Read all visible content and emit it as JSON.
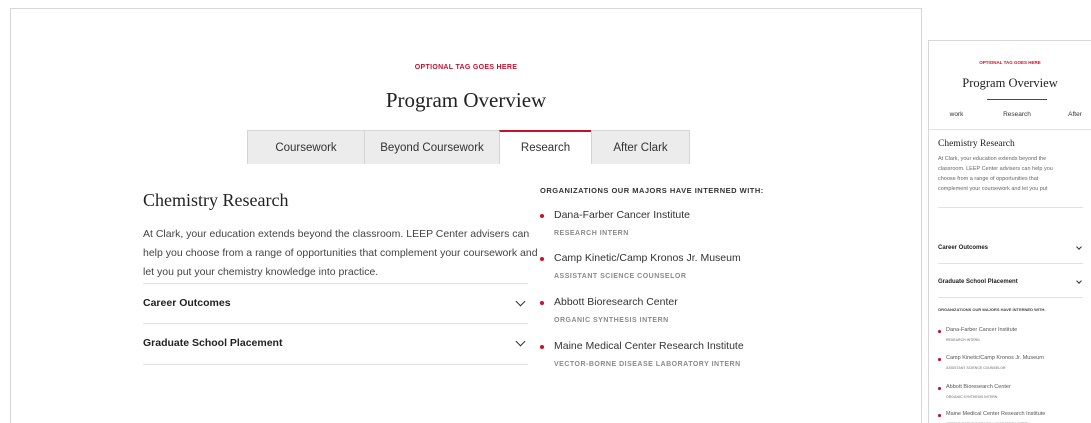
{
  "header": {
    "tag": "OPTIONAL TAG GOES HERE",
    "title": "Program Overview"
  },
  "tabs": [
    {
      "label": "Coursework",
      "active": false
    },
    {
      "label": "Beyond Coursework",
      "active": false
    },
    {
      "label": "Research",
      "active": true
    },
    {
      "label": "After Clark",
      "active": false
    }
  ],
  "content": {
    "heading": "Chemistry Research",
    "body": "At Clark, your education extends beyond the classroom. LEEP Center advisers can help you choose from a range of opportunities that complement your coursework and let you put your chemistry knowledge into practice."
  },
  "accordions": [
    {
      "label": "Career Outcomes",
      "icon": "chevron-down-icon"
    },
    {
      "label": "Graduate School Placement",
      "icon": "chevron-down-icon"
    }
  ],
  "organizations": {
    "heading": "ORGANIZATIONS OUR MAJORS HAVE INTERNED WITH:",
    "items": [
      {
        "name": "Dana-Farber Cancer Institute",
        "role": "RESEARCH INTERN"
      },
      {
        "name": "Camp Kinetic/Camp Kronos Jr. Museum",
        "role": "ASSISTANT SCIENCE COUNSELOR"
      },
      {
        "name": "Abbott Bioresearch Center",
        "role": "ORGANIC SYNTHESIS INTERN"
      },
      {
        "name": "Maine Medical Center Research Institute",
        "role": "VECTOR-BORNE DISEASE LABORATORY INTERN"
      }
    ]
  },
  "mobile": {
    "tag": "OPTIONAL TAG GOES HERE",
    "title": "Program Overview",
    "tabs": [
      "work",
      "Research",
      "After"
    ],
    "heading": "Chemistry Research",
    "body_lines": [
      "At Clark, your education extends beyond the",
      "classroom. LEEP Center advisers can help you",
      "choose from a range of opportunities that",
      "complement your coursework and let you put"
    ]
  },
  "colors": {
    "accent": "#c8102e",
    "tab_inactive_bg": "#ececec",
    "border": "#d4d4d4"
  }
}
